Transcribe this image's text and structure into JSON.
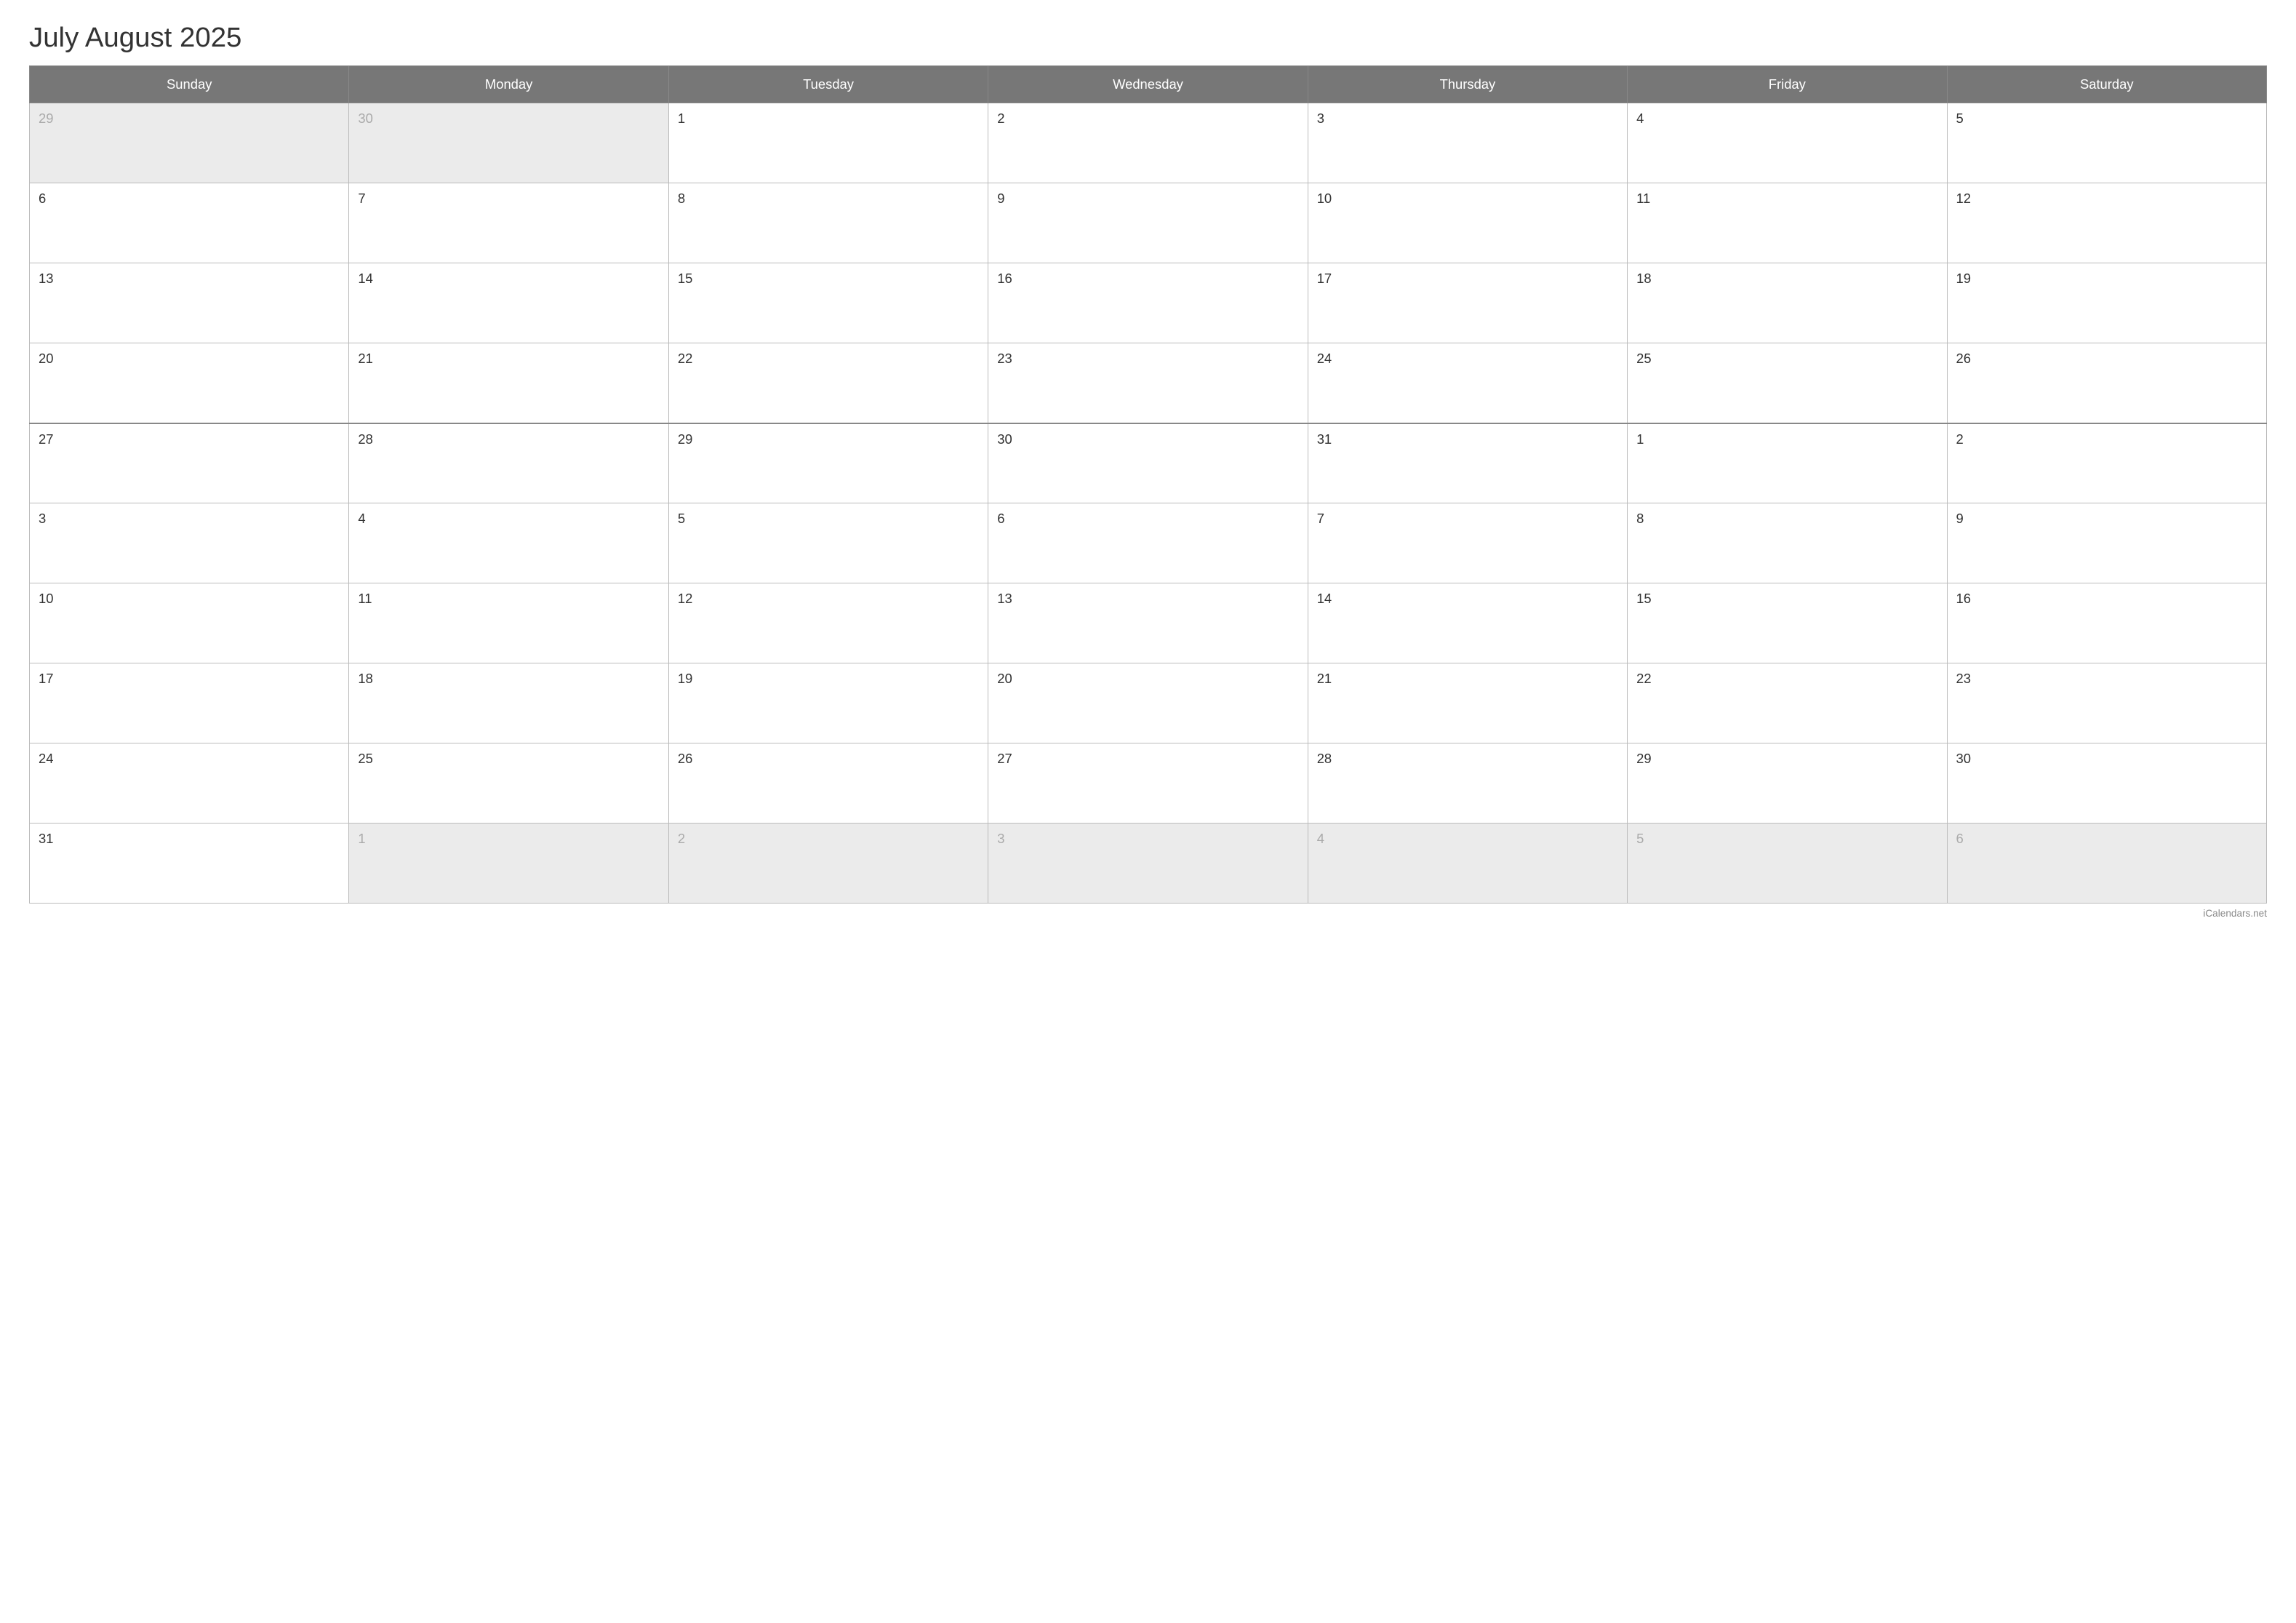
{
  "title": "July August 2025",
  "header": {
    "days": [
      "Sunday",
      "Monday",
      "Tuesday",
      "Wednesday",
      "Thursday",
      "Friday",
      "Saturday"
    ]
  },
  "weeks": [
    {
      "cells": [
        {
          "label": "29",
          "type": "prev-month"
        },
        {
          "label": "30",
          "type": "prev-month"
        },
        {
          "label": "1",
          "type": "current"
        },
        {
          "label": "2",
          "type": "current"
        },
        {
          "label": "3",
          "type": "current"
        },
        {
          "label": "4",
          "type": "current"
        },
        {
          "label": "5",
          "type": "current"
        }
      ]
    },
    {
      "cells": [
        {
          "label": "6",
          "type": "current"
        },
        {
          "label": "7",
          "type": "current"
        },
        {
          "label": "8",
          "type": "current"
        },
        {
          "label": "9",
          "type": "current"
        },
        {
          "label": "10",
          "type": "current"
        },
        {
          "label": "11",
          "type": "current"
        },
        {
          "label": "12",
          "type": "current"
        }
      ]
    },
    {
      "cells": [
        {
          "label": "13",
          "type": "current"
        },
        {
          "label": "14",
          "type": "current"
        },
        {
          "label": "15",
          "type": "current"
        },
        {
          "label": "16",
          "type": "current"
        },
        {
          "label": "17",
          "type": "current"
        },
        {
          "label": "18",
          "type": "current"
        },
        {
          "label": "19",
          "type": "current"
        }
      ]
    },
    {
      "cells": [
        {
          "label": "20",
          "type": "current"
        },
        {
          "label": "21",
          "type": "current"
        },
        {
          "label": "22",
          "type": "current"
        },
        {
          "label": "23",
          "type": "current"
        },
        {
          "label": "24",
          "type": "current"
        },
        {
          "label": "25",
          "type": "current"
        },
        {
          "label": "26",
          "type": "current"
        }
      ]
    },
    {
      "divider": true,
      "cells": [
        {
          "label": "27",
          "type": "current"
        },
        {
          "label": "28",
          "type": "current"
        },
        {
          "label": "29",
          "type": "current"
        },
        {
          "label": "30",
          "type": "current"
        },
        {
          "label": "31",
          "type": "current"
        },
        {
          "label": "1",
          "type": "next-month"
        },
        {
          "label": "2",
          "type": "next-month"
        }
      ]
    },
    {
      "cells": [
        {
          "label": "3",
          "type": "next-month"
        },
        {
          "label": "4",
          "type": "next-month"
        },
        {
          "label": "5",
          "type": "next-month"
        },
        {
          "label": "6",
          "type": "next-month"
        },
        {
          "label": "7",
          "type": "next-month"
        },
        {
          "label": "8",
          "type": "next-month"
        },
        {
          "label": "9",
          "type": "next-month"
        }
      ]
    },
    {
      "cells": [
        {
          "label": "10",
          "type": "next-month"
        },
        {
          "label": "11",
          "type": "next-month"
        },
        {
          "label": "12",
          "type": "next-month"
        },
        {
          "label": "13",
          "type": "next-month"
        },
        {
          "label": "14",
          "type": "next-month"
        },
        {
          "label": "15",
          "type": "next-month"
        },
        {
          "label": "16",
          "type": "next-month"
        }
      ]
    },
    {
      "cells": [
        {
          "label": "17",
          "type": "next-month"
        },
        {
          "label": "18",
          "type": "next-month"
        },
        {
          "label": "19",
          "type": "next-month"
        },
        {
          "label": "20",
          "type": "next-month"
        },
        {
          "label": "21",
          "type": "next-month"
        },
        {
          "label": "22",
          "type": "next-month"
        },
        {
          "label": "23",
          "type": "next-month"
        }
      ]
    },
    {
      "cells": [
        {
          "label": "24",
          "type": "next-month"
        },
        {
          "label": "25",
          "type": "next-month"
        },
        {
          "label": "26",
          "type": "next-month"
        },
        {
          "label": "27",
          "type": "next-month"
        },
        {
          "label": "28",
          "type": "next-month"
        },
        {
          "label": "29",
          "type": "next-month"
        },
        {
          "label": "30",
          "type": "next-month"
        }
      ]
    },
    {
      "cells": [
        {
          "label": "31",
          "type": "next-month"
        },
        {
          "label": "1",
          "type": "after-next"
        },
        {
          "label": "2",
          "type": "after-next"
        },
        {
          "label": "3",
          "type": "after-next"
        },
        {
          "label": "4",
          "type": "after-next"
        },
        {
          "label": "5",
          "type": "after-next"
        },
        {
          "label": "6",
          "type": "after-next"
        }
      ]
    }
  ],
  "footer": {
    "text": "iCalendars.net"
  }
}
